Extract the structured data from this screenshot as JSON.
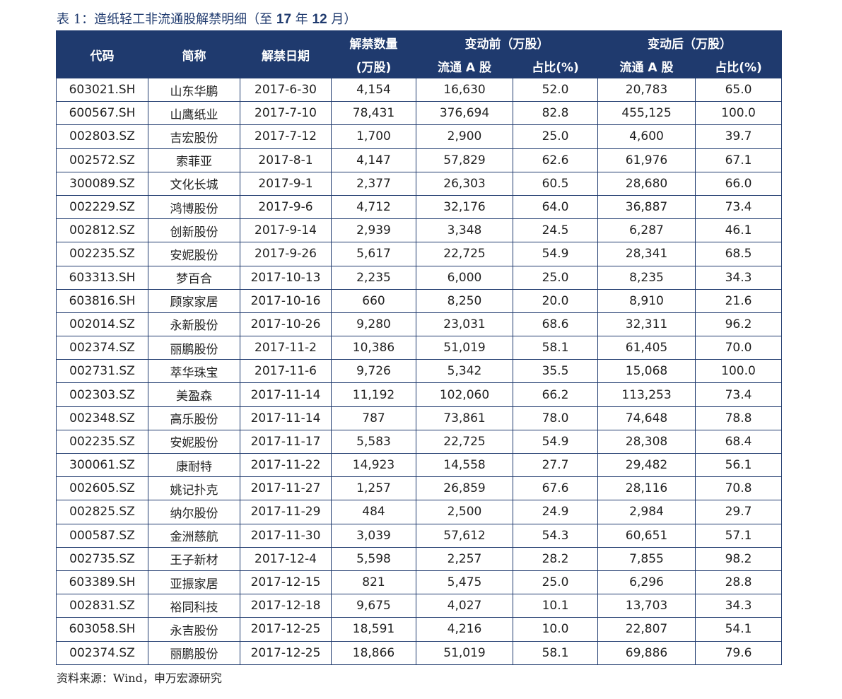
{
  "caption": {
    "prefix": "表 1：造纸轻工非流通股解禁明细（至 ",
    "year": "17",
    "mid": " 年 ",
    "month": "12",
    "suffix": " 月）"
  },
  "headers": {
    "code": "代码",
    "name": "简称",
    "date": "解禁日期",
    "qty_line1": "解禁数量",
    "qty_line2": "(万股)",
    "before": "变动前（万股）",
    "after": "变动后（万股）",
    "float_a": "流通 A 股",
    "ratio": "占比(%)"
  },
  "rows": [
    [
      "603021.SH",
      "山东华鹏",
      "2017-6-30",
      "4,154",
      "16,630",
      "52.0",
      "20,783",
      "65.0"
    ],
    [
      "600567.SH",
      "山鹰纸业",
      "2017-7-10",
      "78,431",
      "376,694",
      "82.8",
      "455,125",
      "100.0"
    ],
    [
      "002803.SZ",
      "吉宏股份",
      "2017-7-12",
      "1,700",
      "2,900",
      "25.0",
      "4,600",
      "39.7"
    ],
    [
      "002572.SZ",
      "索菲亚",
      "2017-8-1",
      "4,147",
      "57,829",
      "62.6",
      "61,976",
      "67.1"
    ],
    [
      "300089.SZ",
      "文化长城",
      "2017-9-1",
      "2,377",
      "26,303",
      "60.5",
      "28,680",
      "66.0"
    ],
    [
      "002229.SZ",
      "鸿博股份",
      "2017-9-6",
      "4,712",
      "32,176",
      "64.0",
      "36,887",
      "73.4"
    ],
    [
      "002812.SZ",
      "创新股份",
      "2017-9-14",
      "2,939",
      "3,348",
      "24.5",
      "6,287",
      "46.1"
    ],
    [
      "002235.SZ",
      "安妮股份",
      "2017-9-26",
      "5,617",
      "22,725",
      "54.9",
      "28,341",
      "68.5"
    ],
    [
      "603313.SH",
      "梦百合",
      "2017-10-13",
      "2,235",
      "6,000",
      "25.0",
      "8,235",
      "34.3"
    ],
    [
      "603816.SH",
      "顾家家居",
      "2017-10-16",
      "660",
      "8,250",
      "20.0",
      "8,910",
      "21.6"
    ],
    [
      "002014.SZ",
      "永新股份",
      "2017-10-26",
      "9,280",
      "23,031",
      "68.6",
      "32,311",
      "96.2"
    ],
    [
      "002374.SZ",
      "丽鹏股份",
      "2017-11-2",
      "10,386",
      "51,019",
      "58.1",
      "61,405",
      "70.0"
    ],
    [
      "002731.SZ",
      "萃华珠宝",
      "2017-11-6",
      "9,726",
      "5,342",
      "35.5",
      "15,068",
      "100.0"
    ],
    [
      "002303.SZ",
      "美盈森",
      "2017-11-14",
      "11,192",
      "102,060",
      "66.2",
      "113,253",
      "73.4"
    ],
    [
      "002348.SZ",
      "高乐股份",
      "2017-11-14",
      "787",
      "73,861",
      "78.0",
      "74,648",
      "78.8"
    ],
    [
      "002235.SZ",
      "安妮股份",
      "2017-11-17",
      "5,583",
      "22,725",
      "54.9",
      "28,308",
      "68.4"
    ],
    [
      "300061.SZ",
      "康耐特",
      "2017-11-22",
      "14,923",
      "14,558",
      "27.7",
      "29,482",
      "56.1"
    ],
    [
      "002605.SZ",
      "姚记扑克",
      "2017-11-27",
      "1,257",
      "26,859",
      "67.6",
      "28,116",
      "70.8"
    ],
    [
      "002825.SZ",
      "纳尔股份",
      "2017-11-29",
      "484",
      "2,500",
      "24.9",
      "2,984",
      "29.7"
    ],
    [
      "000587.SZ",
      "金洲慈航",
      "2017-11-30",
      "3,039",
      "57,612",
      "54.3",
      "60,651",
      "57.1"
    ],
    [
      "002735.SZ",
      "王子新材",
      "2017-12-4",
      "5,598",
      "2,257",
      "28.2",
      "7,855",
      "98.2"
    ],
    [
      "603389.SH",
      "亚振家居",
      "2017-12-15",
      "821",
      "5,475",
      "25.0",
      "6,296",
      "28.8"
    ],
    [
      "002831.SZ",
      "裕同科技",
      "2017-12-18",
      "9,675",
      "4,027",
      "10.1",
      "13,703",
      "34.3"
    ],
    [
      "603058.SH",
      "永吉股份",
      "2017-12-25",
      "18,591",
      "4,216",
      "10.0",
      "22,807",
      "54.1"
    ],
    [
      "002374.SZ",
      "丽鹏股份",
      "2017-12-25",
      "18,866",
      "51,019",
      "58.1",
      "69,886",
      "79.6"
    ]
  ],
  "source": "资料来源：Wind，申万宏源研究"
}
